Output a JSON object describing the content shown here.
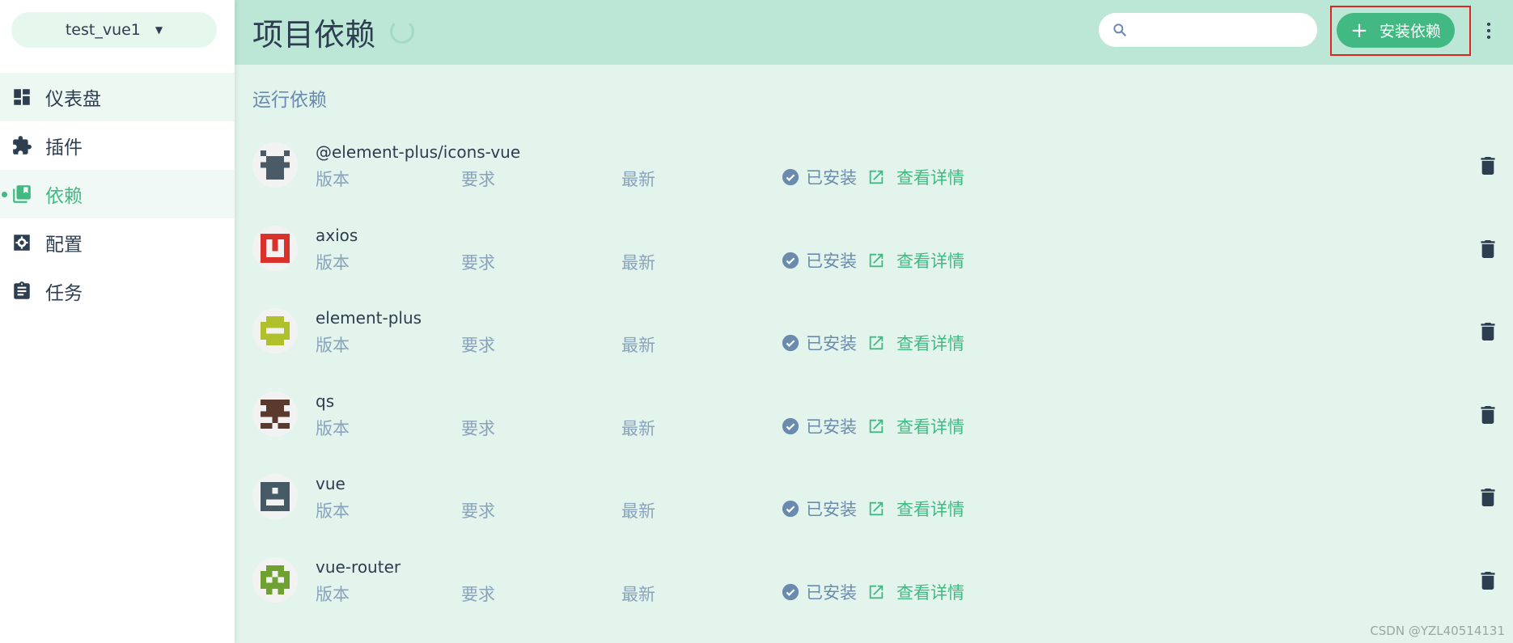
{
  "sidebar": {
    "project": "test_vue1",
    "items": [
      {
        "label": "仪表盘",
        "icon": "dashboard-icon"
      },
      {
        "label": "插件",
        "icon": "puzzle-icon"
      },
      {
        "label": "依赖",
        "icon": "library-icon"
      },
      {
        "label": "配置",
        "icon": "settings-icon"
      },
      {
        "label": "任务",
        "icon": "clipboard-icon"
      }
    ]
  },
  "header": {
    "title": "项目依赖",
    "search_placeholder": "",
    "install_label": "安装依赖"
  },
  "section": {
    "title": "运行依赖"
  },
  "labels": {
    "version": "版本",
    "require": "要求",
    "latest": "最新",
    "installed": "已安装",
    "details": "查看详情"
  },
  "dependencies": [
    {
      "name": "@element-plus/icons-vue",
      "avatar_color": "#4a5a66"
    },
    {
      "name": "axios",
      "avatar_color": "#d9312b"
    },
    {
      "name": "element-plus",
      "avatar_color": "#b0c02a"
    },
    {
      "name": "qs",
      "avatar_color": "#5a3a2c"
    },
    {
      "name": "vue",
      "avatar_color": "#455a64"
    },
    {
      "name": "vue-router",
      "avatar_color": "#6ea12f"
    }
  ],
  "colors": {
    "accent": "#42b983",
    "text": "#2c3e50",
    "muted": "#6a8bad"
  },
  "watermark": "CSDN @YZL40514131"
}
